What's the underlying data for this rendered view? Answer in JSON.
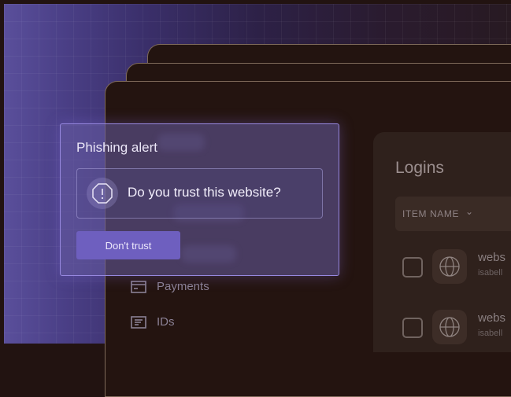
{
  "alert": {
    "title": "Phishing alert",
    "question": "Do you trust this website?",
    "dont_trust_label": "Don't trust",
    "icon": "warning-octagon-icon"
  },
  "sidebar": {
    "items": [
      {
        "label": "Payments",
        "icon": "card-icon"
      },
      {
        "label": "IDs",
        "icon": "id-card-icon"
      }
    ]
  },
  "logins": {
    "title": "Logins",
    "column_header": "ITEM NAME",
    "sort_icon": "chevron-down-icon",
    "rows": [
      {
        "title": "webs",
        "subtitle": "isabell",
        "icon": "globe-icon"
      },
      {
        "title": "webs",
        "subtitle": "isabell",
        "icon": "globe-icon"
      }
    ]
  },
  "colors": {
    "accent": "#6e5fbf",
    "alert_border": "#9788e0",
    "window_bg": "#231410"
  }
}
